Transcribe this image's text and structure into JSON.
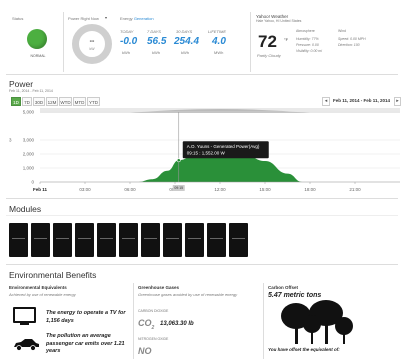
{
  "status": {
    "label": "Status",
    "value": "NORMAL",
    "color": "#4caf40"
  },
  "power_right_now": {
    "label": "Power Right Now",
    "value": "--",
    "unit": "kW"
  },
  "energy": {
    "label": "Energy",
    "label_accent": "Generation",
    "columns": [
      {
        "period": "TODAY",
        "value": "-0.0",
        "unit": "kWh"
      },
      {
        "period": "7 DAYS",
        "value": "56.5",
        "unit": "kWh"
      },
      {
        "period": "30 DAYS",
        "value": "254.4",
        "unit": "kWh"
      },
      {
        "period": "LIFETIME",
        "value": "4.0",
        "unit": "MWh"
      }
    ]
  },
  "weather": {
    "label": "Yahoo! Weather",
    "location": "Hale Yahoo, HI United States",
    "temp": "72",
    "temp_unit": "°F",
    "condition": "Partly Cloudy",
    "atmo_label": "Atmosphere",
    "humidity": "Humidity: 77%",
    "pressure": "Pressure: 0.00",
    "visibility": "Visibility: 0.00 mi",
    "wind_label": "Wind",
    "speed": "Speed: 0.00 MPH",
    "direction": "Direction: 100"
  },
  "power": {
    "title": "Power",
    "date_range_small": "Feb 11, 2014 - Feb 11, 2014",
    "date_range": "Feb 11, 2014 - Feb 11, 2014",
    "ranges": [
      "1D",
      "7D",
      "30D",
      "12M",
      "WTD",
      "MTD",
      "YTD"
    ],
    "active_range": "1D"
  },
  "chart_data": {
    "type": "area",
    "title": "",
    "series": [
      {
        "name": "A.O. Yuuns - Generated Power(Avg)",
        "color": "#1f8a2e"
      }
    ],
    "x_ticks": [
      "Feb 11",
      "03:00",
      "06:00",
      "09:00",
      "12:00",
      "15:00",
      "18:00",
      "21:00"
    ],
    "y_ticks": [
      "0",
      "1,000",
      "2,000",
      "3,000",
      "5,000"
    ],
    "ylim": [
      0,
      5000
    ],
    "points": [
      [
        "06:30",
        0
      ],
      [
        "07:30",
        200
      ],
      [
        "08:30",
        800
      ],
      [
        "09:15",
        1552
      ],
      [
        "10:30",
        2050
      ],
      [
        "12:00",
        2280
      ],
      [
        "13:30",
        2050
      ],
      [
        "15:00",
        1500
      ],
      [
        "16:30",
        600
      ],
      [
        "17:30",
        0
      ]
    ],
    "tooltip": {
      "title": "A.O. Yuuns - Generated Power(Avg)",
      "text": "09:15 : 1,552.00 W"
    },
    "cursor_label": "09:15",
    "left_axis_label": "3"
  },
  "modules": {
    "title": "Modules",
    "count": 11
  },
  "env": {
    "title": "Environmental Benefits",
    "equiv": {
      "title": "Environmental Equivalents",
      "sub": "Achieved by use of renewable energy",
      "tv": "The energy to operate a TV for 1,156 days",
      "car": "The pollution an average passenger car emits over 1.21 years"
    },
    "ghg": {
      "title": "Greenhouse Gases",
      "sub": "Greenhouse gases avoided by use of renewable energy",
      "co2_label": "CARBON DIOXIDE",
      "co2_sym": "CO",
      "co2_sub": "2",
      "co2_val": "13,063.30 lb",
      "no_label": "NITROGEN OXIDE",
      "no_sym": "NO"
    },
    "carbon": {
      "title": "Carbon Offset",
      "value": "5.47 metric tons",
      "note": "You have offset the equivalent of:"
    }
  }
}
